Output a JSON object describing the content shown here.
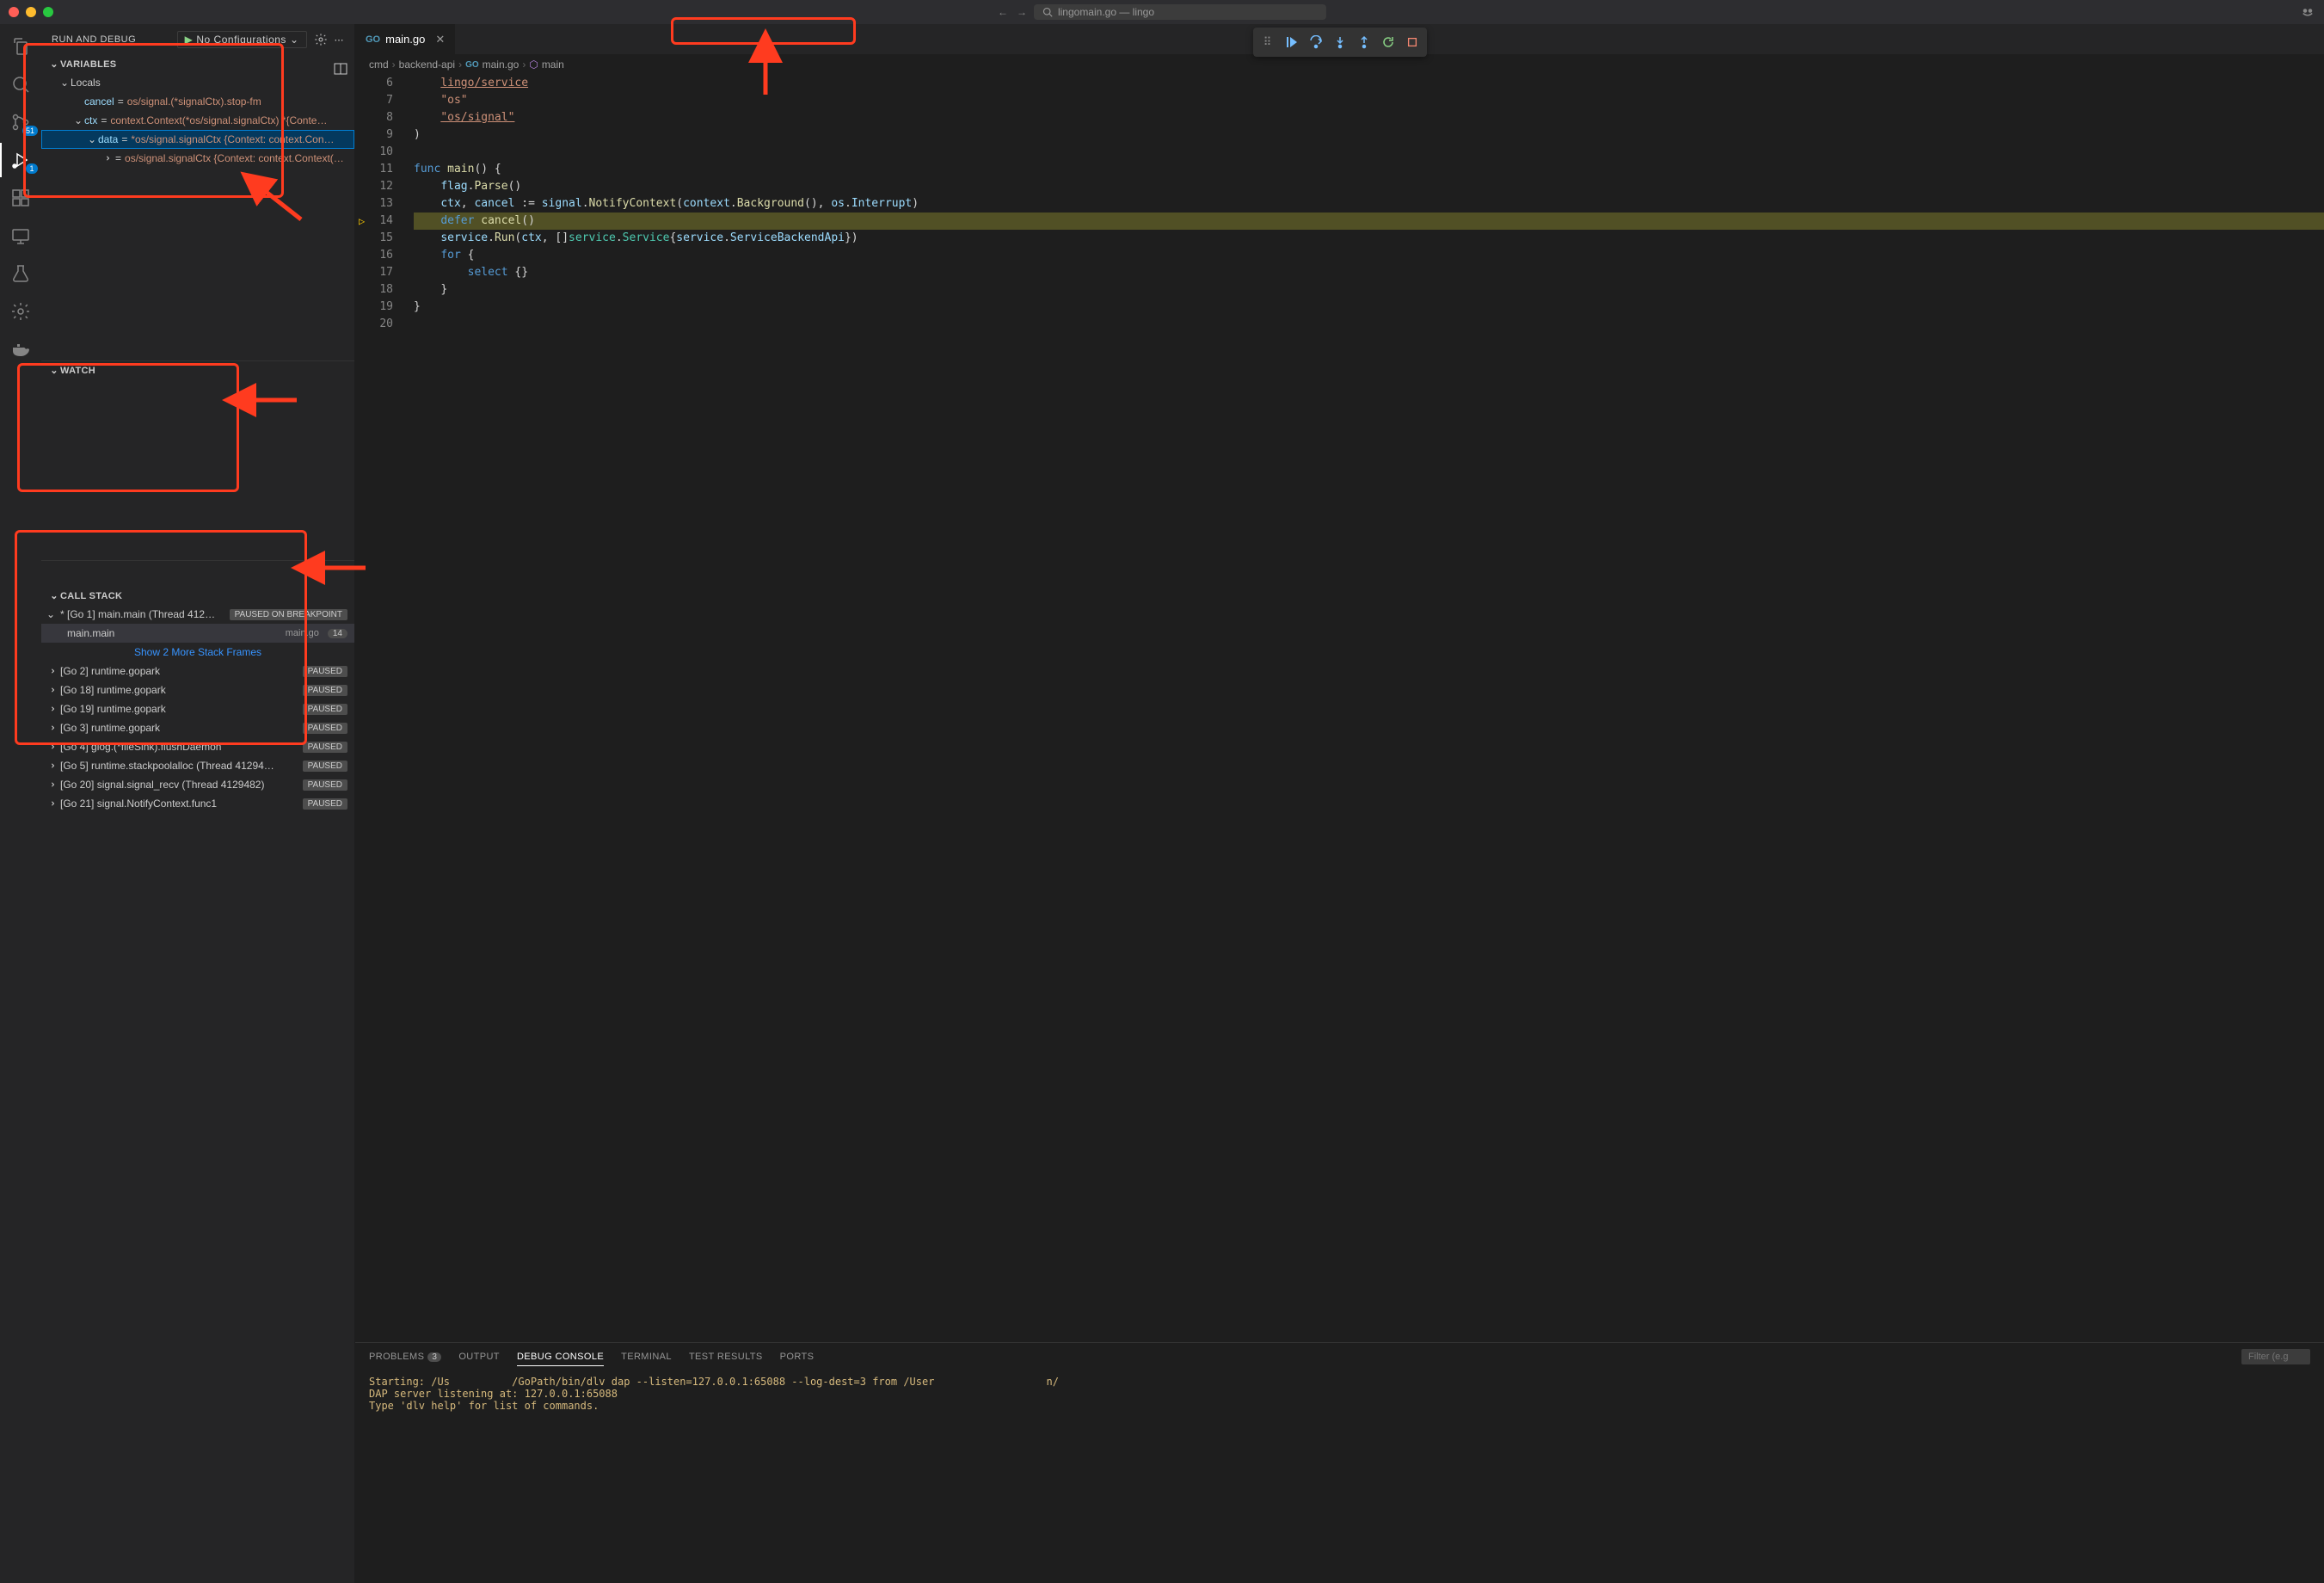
{
  "window": {
    "title_search": "lingomain.go — lingo",
    "nav_back": "←",
    "nav_fwd": "→"
  },
  "activity": {
    "badges": {
      "scm": "51",
      "debug": "1"
    }
  },
  "sidebar": {
    "title": "RUN AND DEBUG",
    "config": "No Configurations",
    "sections": {
      "variables": "VARIABLES",
      "watch": "WATCH",
      "callstack": "CALL STACK"
    },
    "locals_label": "Locals",
    "vars": {
      "cancel": {
        "name": "cancel",
        "value": "os/signal.(*signalCtx).stop-fm"
      },
      "ctx": {
        "name": "ctx",
        "value": "context.Context(*os/signal.signalCtx) *{Conte…"
      },
      "data": {
        "name": "data",
        "value": "*os/signal.signalCtx {Context: context.Con…"
      },
      "inner": {
        "name": "",
        "value": "os/signal.signalCtx {Context: context.Context(…"
      }
    }
  },
  "callstack": {
    "thread": "* [Go 1] main.main (Thread 412…",
    "thread_status": "PAUSED ON BREAKPOINT",
    "frame_func": "main.main",
    "frame_file": "main.go",
    "frame_line": "14",
    "show_more": "Show 2 More Stack Frames",
    "rows": [
      {
        "label": "[Go 2] runtime.gopark",
        "status": "PAUSED"
      },
      {
        "label": "[Go 18] runtime.gopark",
        "status": "PAUSED"
      },
      {
        "label": "[Go 19] runtime.gopark",
        "status": "PAUSED"
      },
      {
        "label": "[Go 3] runtime.gopark",
        "status": "PAUSED"
      },
      {
        "label": "[Go 4] glog.(*fileSink).flushDaemon",
        "status": "PAUSED"
      },
      {
        "label": "[Go 5] runtime.stackpoolalloc (Thread 41294…",
        "status": "PAUSED"
      },
      {
        "label": "[Go 20] signal.signal_recv (Thread 4129482)",
        "status": "PAUSED"
      },
      {
        "label": "[Go 21] signal.NotifyContext.func1",
        "status": "PAUSED"
      }
    ]
  },
  "tab": {
    "filename": "main.go"
  },
  "breadcrumb": {
    "p1": "cmd",
    "p2": "backend-api",
    "p3": "main.go",
    "p4": "main"
  },
  "code": {
    "line_nos": [
      "6",
      "7",
      "8",
      "9",
      "10",
      "11",
      "12",
      "13",
      "14",
      "15",
      "16",
      "17",
      "18",
      "19",
      "20"
    ],
    "l6": "lingo/service",
    "l7": "\"os\"",
    "l8": "\"os/signal\"",
    "l14": "defer cancel()"
  },
  "panel": {
    "tabs": {
      "problems": "PROBLEMS",
      "problems_count": "3",
      "output": "OUTPUT",
      "debug": "DEBUG CONSOLE",
      "terminal": "TERMINAL",
      "test": "TEST RESULTS",
      "ports": "PORTS"
    },
    "filter_ph": "Filter (e.g",
    "line1": "Starting: /Us          /GoPath/bin/dlv dap --listen=127.0.0.1:65088 --log-dest=3 from /User",
    "line2": "DAP server listening at: 127.0.0.1:65088",
    "line3": "Type 'dlv help' for list of commands."
  }
}
